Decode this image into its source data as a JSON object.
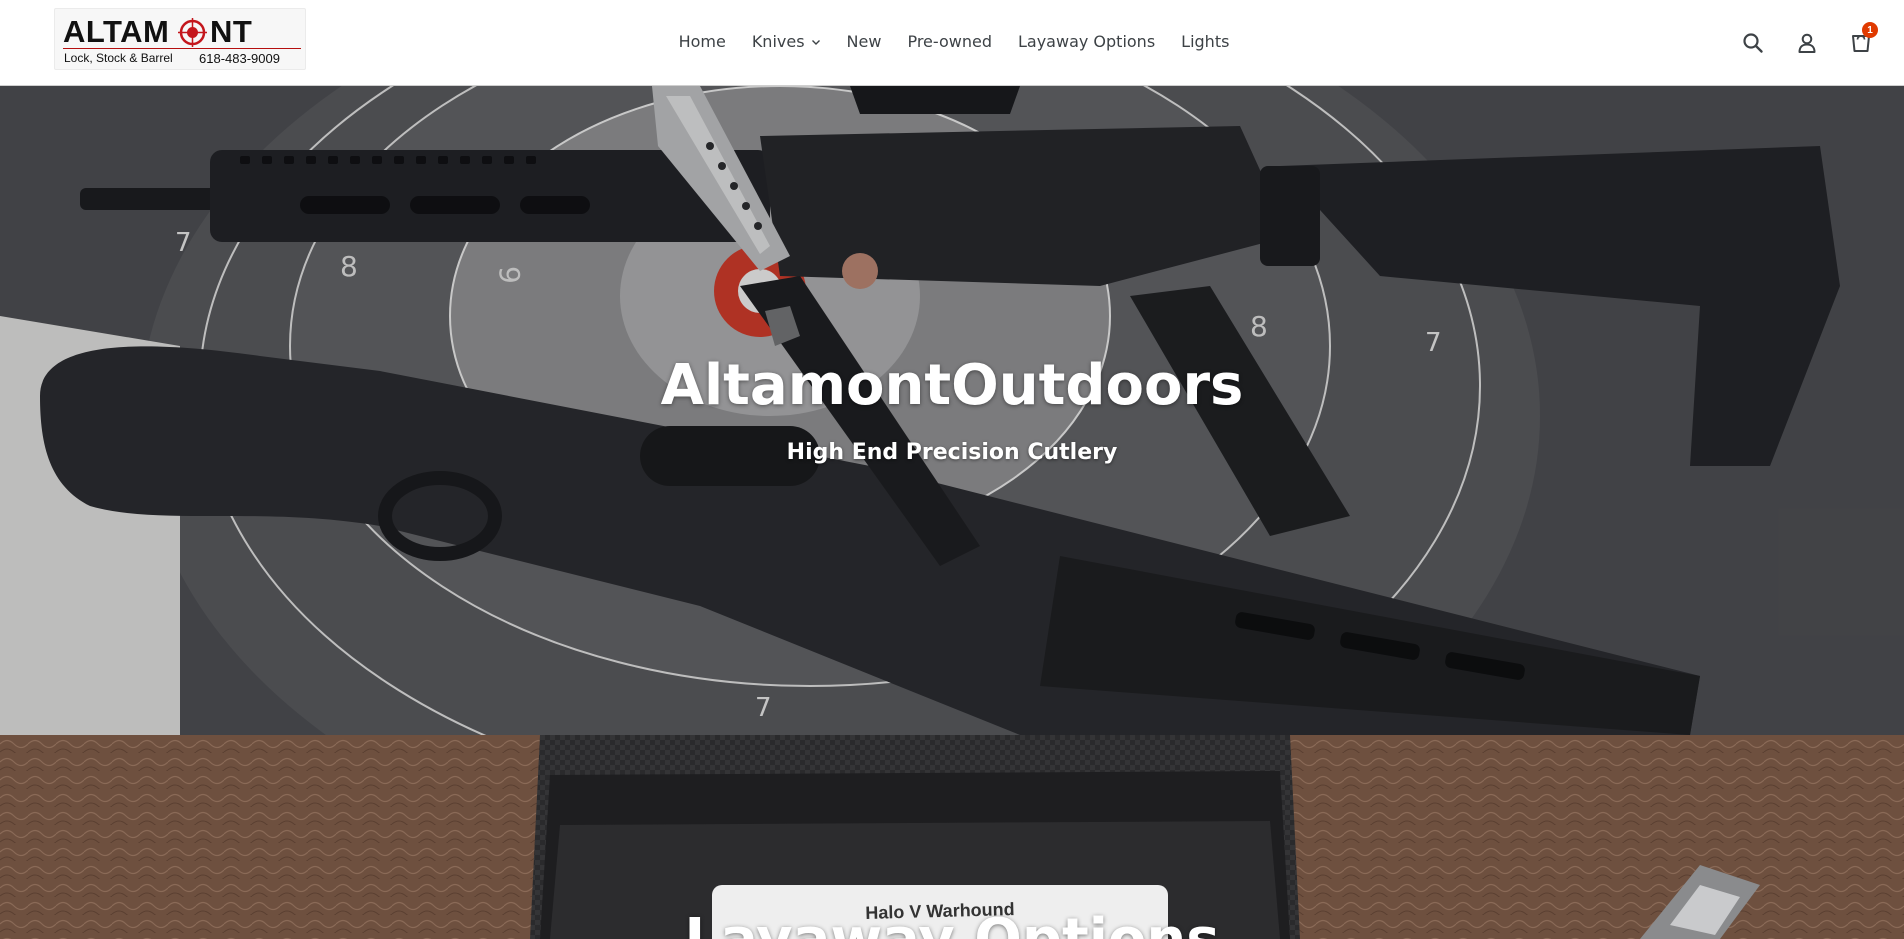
{
  "header": {
    "logo": {
      "word_start": "ALTAM",
      "word_end": "NT",
      "tagline": "Lock, Stock & Barrel",
      "phone": "618-483-9009"
    },
    "nav": [
      {
        "label": "Home",
        "has_dropdown": false
      },
      {
        "label": "Knives",
        "has_dropdown": true
      },
      {
        "label": "New",
        "has_dropdown": false
      },
      {
        "label": "Pre-owned",
        "has_dropdown": false
      },
      {
        "label": "Layaway Options",
        "has_dropdown": false
      },
      {
        "label": "Lights",
        "has_dropdown": false
      }
    ],
    "icons": {
      "search": "search-icon",
      "account": "account-icon",
      "cart": "cart-icon"
    },
    "cart_count": "1",
    "cart_badge_color": "#e03a00"
  },
  "hero": {
    "title": "AltamontOutdoors",
    "subtitle": "High End Precision Cutlery"
  },
  "slide_two": {
    "box_label": "Halo V Warhound",
    "title_partial": "Layaway Options"
  }
}
